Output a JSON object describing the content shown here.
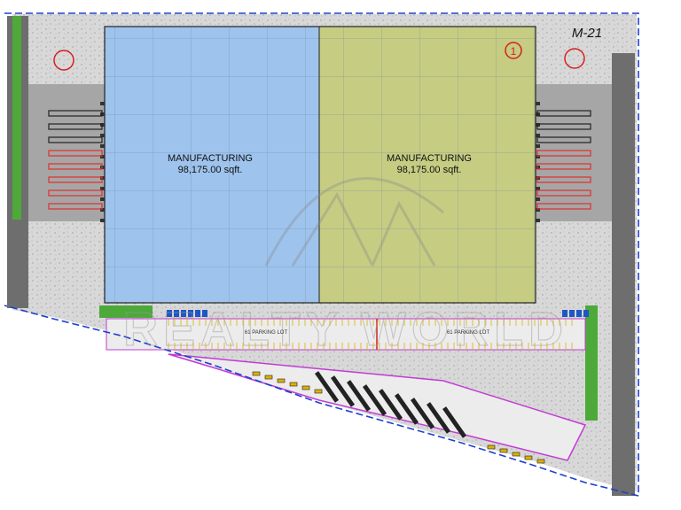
{
  "sheet": {
    "code": "M-21",
    "building_number": "1"
  },
  "buildings": [
    {
      "id": "west",
      "use": "MANUFACTURING",
      "area": "98,175.00 sqft.",
      "color": "#9ec3ec"
    },
    {
      "id": "east",
      "use": "MANUFACTURING",
      "area": "98,175.00 sqft.",
      "color": "#c6cc82"
    }
  ],
  "parking": [
    {
      "label": "61 PARKING LOT"
    },
    {
      "label": "61 PARKING LOT"
    }
  ],
  "watermark": {
    "text": "REALTY WORLD"
  },
  "colors": {
    "boundary": "#1f3fd0",
    "ground": "#d4d4d4",
    "landscape": "#4da93a",
    "road": "#7a7a7a",
    "curb": "#c23bd4",
    "truck_stall": "#e03030",
    "accent": "#d42020"
  }
}
